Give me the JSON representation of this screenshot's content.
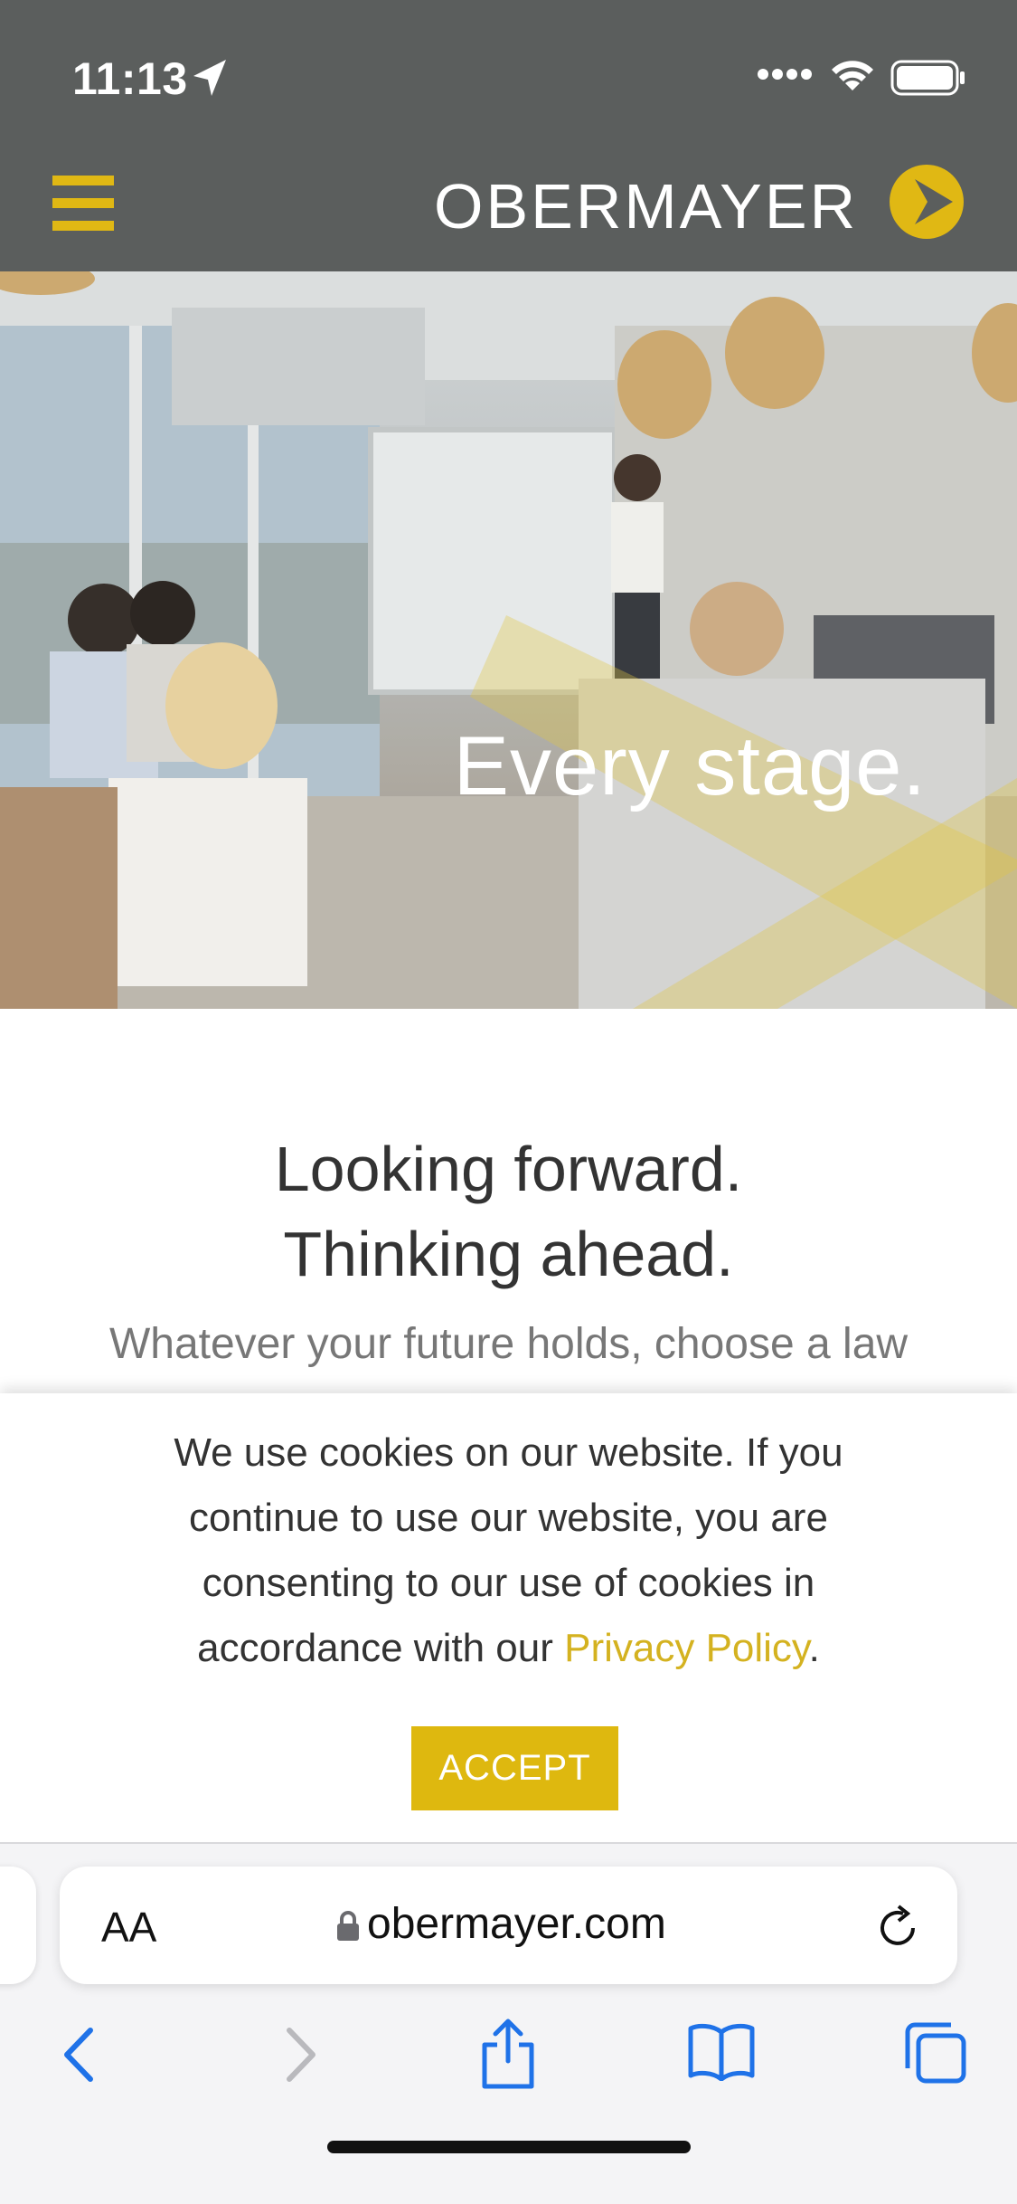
{
  "status_bar": {
    "time": "11:13"
  },
  "header": {
    "brand": "OBERMAYER",
    "brand_color": "#e0b814"
  },
  "hero": {
    "overlay_text": "Every stage."
  },
  "intro": {
    "headline_line1": "Looking forward.",
    "headline_line2": "Thinking ahead.",
    "lead": "Whatever your future holds, choose a law"
  },
  "cookie_banner": {
    "text": "We use cookies on our website. If you continue to use our website, you are consenting to our use of cookies in accordance with our ",
    "link_label": "Privacy Policy",
    "suffix": ".",
    "accept_label": "ACCEPT"
  },
  "browser": {
    "text_size_label": "AA",
    "url": "obermayer.com"
  },
  "colors": {
    "accent": "#deb80f",
    "header_bg": "#5b5e5d",
    "ios_blue": "#1f72e8"
  }
}
